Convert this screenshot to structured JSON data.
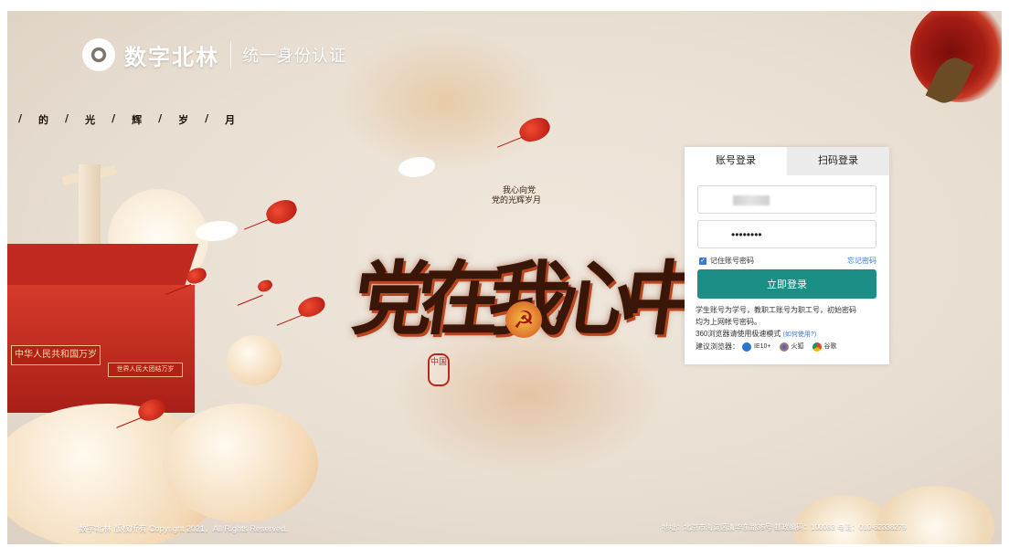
{
  "header": {
    "brand": "数字北林",
    "subtitle": "统一身份认证"
  },
  "slogan": [
    "/",
    "的",
    "/",
    "光",
    "/",
    "辉",
    "/",
    "岁",
    "/",
    "月"
  ],
  "art": {
    "poem_line1": "我心向党",
    "poem_line2": "党的光辉岁月",
    "headline": "党在我心中",
    "gate_sign": "中华人民共和国万岁",
    "gate_sign2": "世界人民大团结万岁",
    "seal": "中国"
  },
  "login": {
    "tabs": [
      {
        "label": "账号登录",
        "active": true
      },
      {
        "label": "扫码登录",
        "active": false
      }
    ],
    "password_value": "••••••••",
    "remember_label": "记住账号密码",
    "remember_checked": true,
    "forgot_label": "忘记密码",
    "submit_label": "立即登录",
    "note_line1": "学生账号为学号，教职工账号为职工号，初始密码",
    "note_line2": "均为上网帐号密码。",
    "note_360": "360浏览器请使用极速模式",
    "note_360_help": "(如何使用?)",
    "suggest_label": "建议浏览器：",
    "browsers": [
      {
        "name": "IE10+",
        "icon": "ie-icon"
      },
      {
        "name": "火狐",
        "icon": "firefox-icon"
      },
      {
        "name": "谷歌",
        "icon": "chrome-icon"
      }
    ]
  },
  "footer": {
    "copyright": "数字北林 版权所有 Copyright 2021，All Rights Reserved.",
    "address": "地址：北京市海淀区清华东路35号 邮政编码：100083 电话：010-62338279"
  },
  "colors": {
    "accent": "#1b8f86",
    "link": "#3d79d8"
  }
}
